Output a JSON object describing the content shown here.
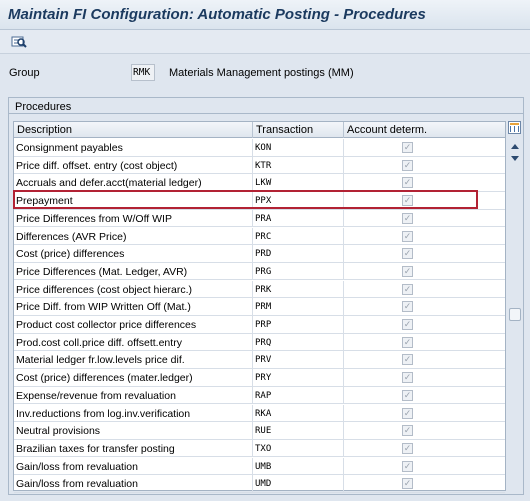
{
  "window": {
    "title": "Maintain FI Configuration: Automatic Posting - Procedures"
  },
  "toolbar": {
    "icons": [
      "find-icon"
    ]
  },
  "group": {
    "label": "Group",
    "value": "RMK",
    "description": "Materials Management postings (MM)"
  },
  "procedures": {
    "title": "Procedures",
    "columns": [
      "Description",
      "Transaction",
      "Account determ."
    ],
    "selected_row_index": 3,
    "rows": [
      {
        "description": "Consignment payables",
        "transaction": "KON",
        "checked": true
      },
      {
        "description": "Price diff. offset. entry (cost object)",
        "transaction": "KTR",
        "checked": true
      },
      {
        "description": "Accruals and defer.acct(material ledger)",
        "transaction": "LKW",
        "checked": true
      },
      {
        "description": "Prepayment",
        "transaction": "PPX",
        "checked": true
      },
      {
        "description": "Price Differences from W/Off WIP",
        "transaction": "PRA",
        "checked": true
      },
      {
        "description": "Differences (AVR Price)",
        "transaction": "PRC",
        "checked": true
      },
      {
        "description": "Cost (price) differences",
        "transaction": "PRD",
        "checked": true
      },
      {
        "description": "Price Differences (Mat. Ledger, AVR)",
        "transaction": "PRG",
        "checked": true
      },
      {
        "description": "Price differences (cost object hierarc.)",
        "transaction": "PRK",
        "checked": true
      },
      {
        "description": "Price Diff. from WIP Written Off (Mat.)",
        "transaction": "PRM",
        "checked": true
      },
      {
        "description": "Product cost collector price differences",
        "transaction": "PRP",
        "checked": true
      },
      {
        "description": "Prod.cost coll.price diff. offsett.entry",
        "transaction": "PRQ",
        "checked": true
      },
      {
        "description": "Material ledger fr.low.levels price dif.",
        "transaction": "PRV",
        "checked": true
      },
      {
        "description": "Cost (price) differences (mater.ledger)",
        "transaction": "PRY",
        "checked": true
      },
      {
        "description": "Expense/revenue from revaluation",
        "transaction": "RAP",
        "checked": true
      },
      {
        "description": "Inv.reductions from log.inv.verification",
        "transaction": "RKA",
        "checked": true
      },
      {
        "description": "Neutral provisions",
        "transaction": "RUE",
        "checked": true
      },
      {
        "description": "Brazilian taxes for transfer posting",
        "transaction": "TXO",
        "checked": true
      },
      {
        "description": "Gain/loss from revaluation",
        "transaction": "UMB",
        "checked": true
      },
      {
        "description": "Gain/loss from revaluation",
        "transaction": "UMD",
        "checked": true
      }
    ]
  },
  "scrollbar": {
    "icons": [
      "column-settings-icon",
      "scroll-up-icon",
      "scroll-down-icon"
    ]
  },
  "colors": {
    "title_text": "#1b3a5f",
    "highlight_border": "#b22234",
    "background": "#dfe6ef"
  }
}
